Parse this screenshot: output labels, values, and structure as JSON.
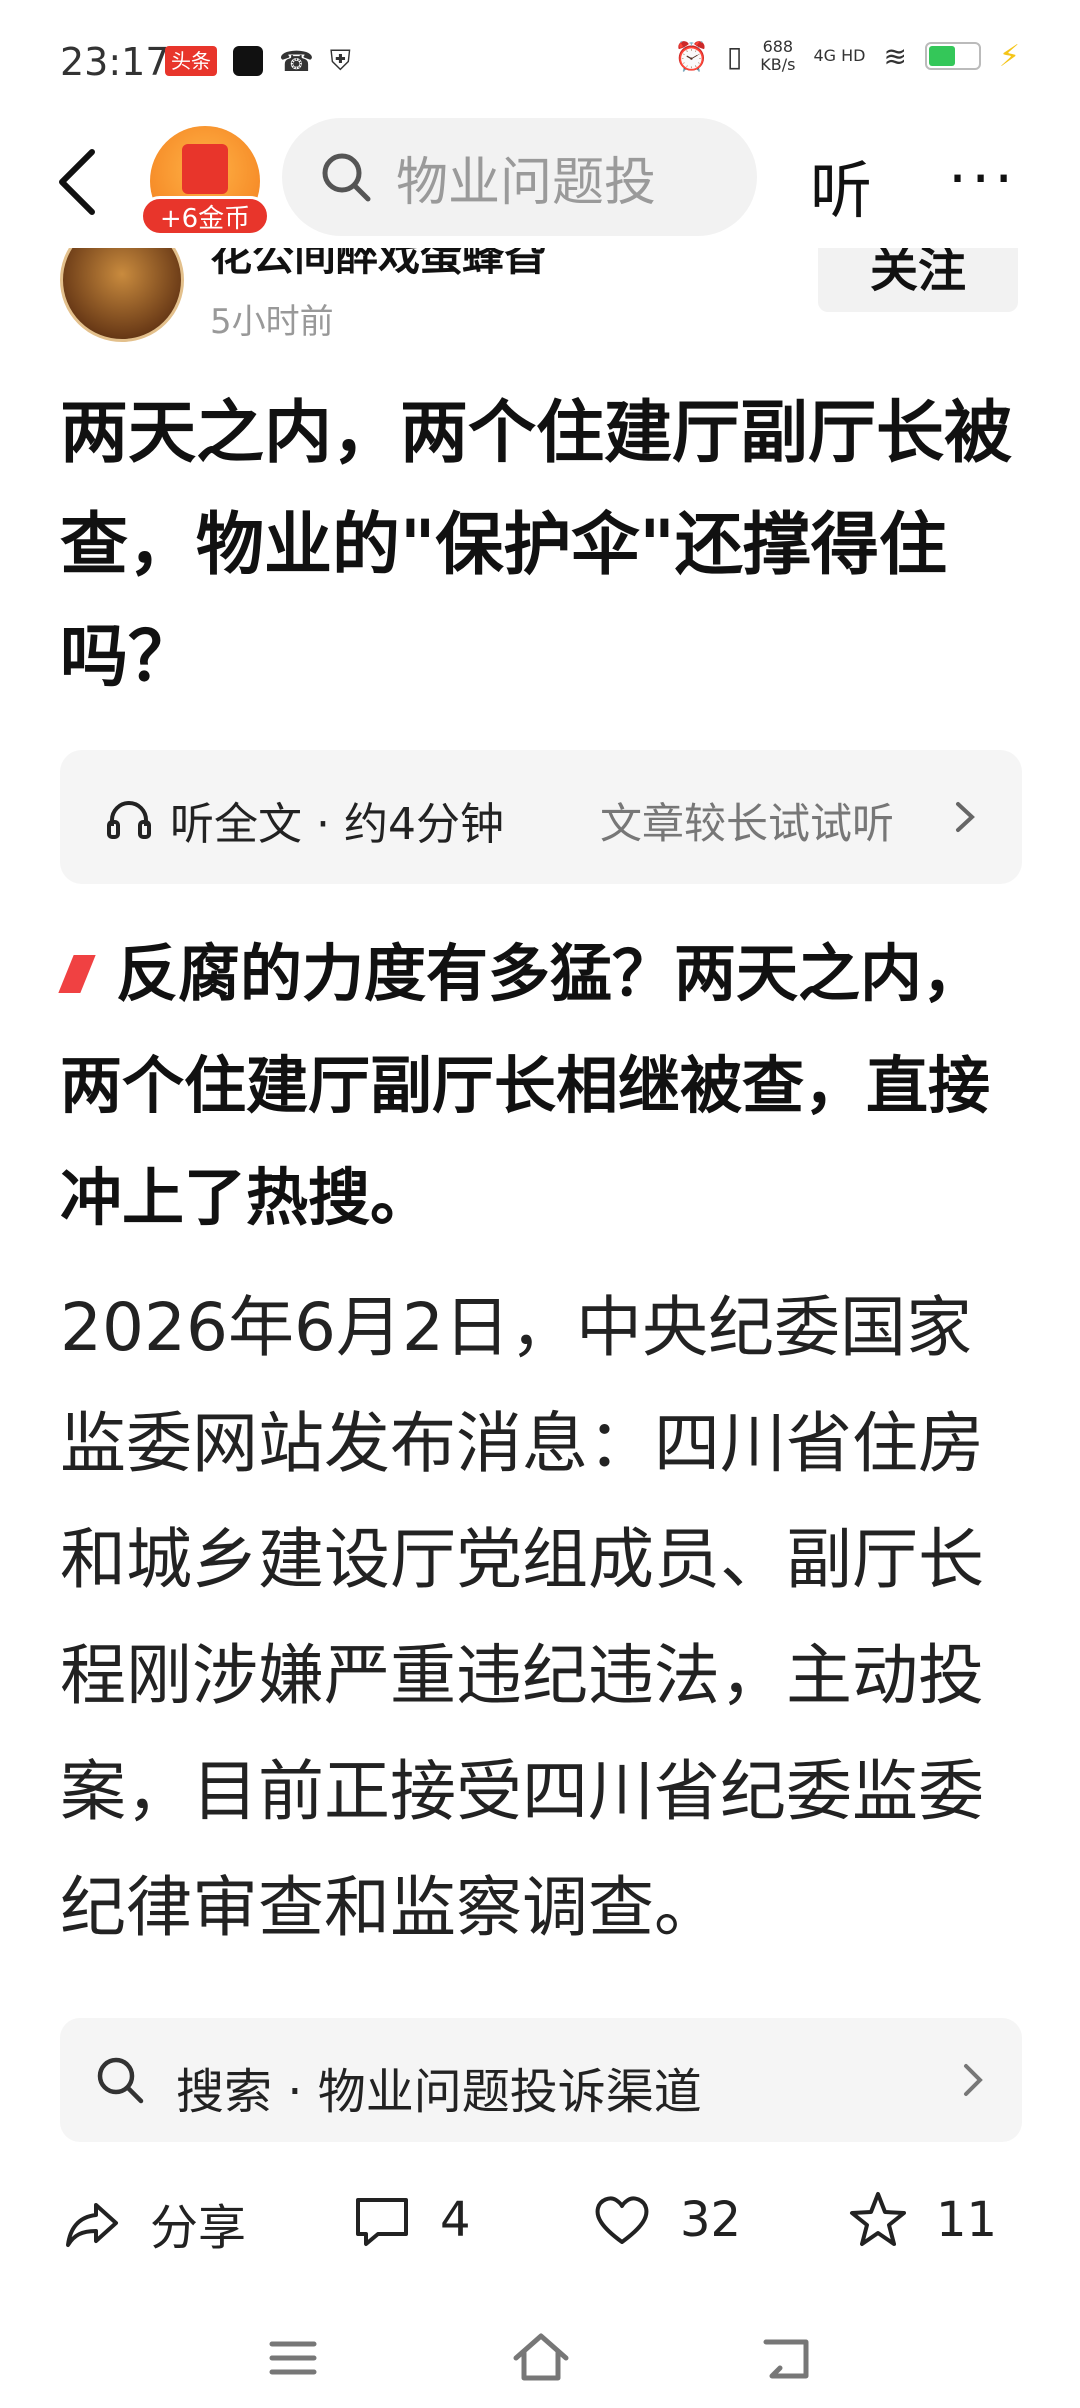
{
  "status_bar": {
    "time": "23:17",
    "app_badge": "头条",
    "net_speed": "688\nKB/s",
    "network": "4G HD",
    "battery_level": 0.55
  },
  "header": {
    "coin_label": "+6金币",
    "search_placeholder": "物业问题投",
    "listen_label": "听",
    "more_label": "···"
  },
  "author": {
    "name": "花公间醉戏蛋蜂旮",
    "time": "5小时前",
    "follow_label": "关注"
  },
  "article": {
    "title": "两天之内，两个住建厅副厅长被查，物业的\"保护伞\"还撑得住吗？",
    "listen_card": {
      "left_text": "听全文 · 约4分钟",
      "right_text": "文章较长试试听"
    },
    "lead": "反腐的力度有多猛？两天之内，两个住建厅副厅长相继被查，直接冲上了热搜。",
    "body": "2026年6月2日，中央纪委国家监委网站发布消息：四川省住房和城乡建设厅党组成员、副厅长程刚涉嫌严重违纪违法，主动投案，目前正接受四川省纪委监委纪律审查和监察调查。"
  },
  "search_suggestion": {
    "text": "搜索 · 物业问题投诉渠道"
  },
  "actions": {
    "share_label": "分享",
    "comment_count": "4",
    "like_count": "32",
    "favorite_count": "11"
  }
}
